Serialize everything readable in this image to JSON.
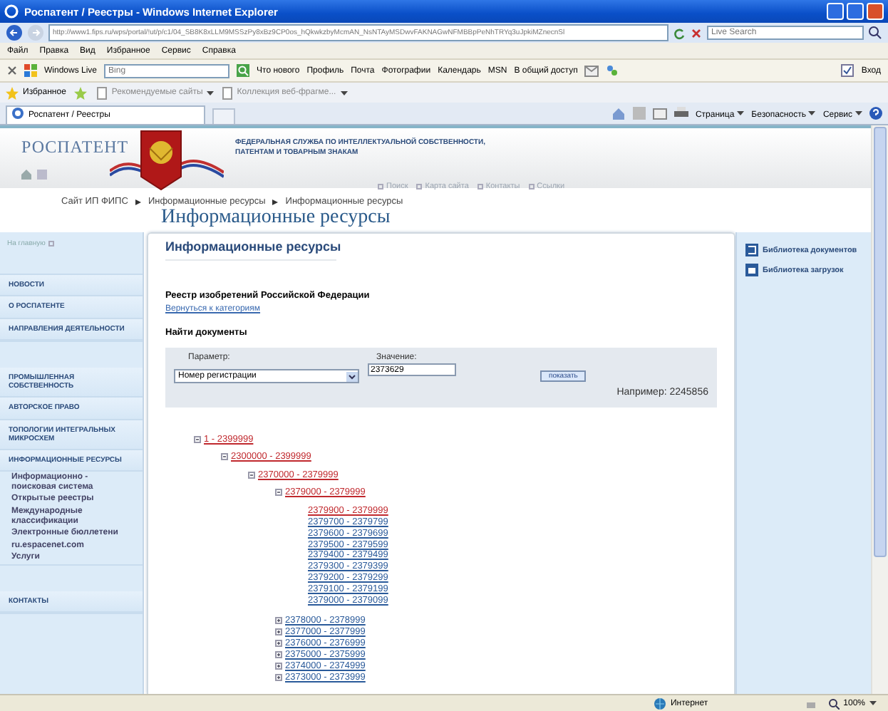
{
  "window": {
    "title": "Роспатент / Реестры - Windows Internet Explorer"
  },
  "browser": {
    "url": "http://www1.fips.ru/wps/portal/!ut/p/c1/04_SB8K8xLLM9MSSzPy8xBz9CP0os_hQkwkzbyMcmAN_NsNTAyMSDwvFAKNAGwNFMBBpPeNhTRYq3uJpkiMZnecnSl",
    "search_placeholder": "Live Search",
    "menu": [
      "Файл",
      "Правка",
      "Вид",
      "Избранное",
      "Сервис",
      "Справка"
    ],
    "live_toolbar": {
      "brand": "Windows Live",
      "search_placeholder": "Bing",
      "links": [
        "Что нового",
        "Профиль",
        "Почта",
        "Фотографии",
        "Календарь",
        "MSN",
        "В общий доступ"
      ],
      "signin": "Вход"
    },
    "favorites": {
      "label": "Избранное",
      "items": [
        "Рекомендуемые сайты",
        "Коллекция веб-фрагме..."
      ]
    },
    "tab": {
      "title": "Роспатент / Реестры"
    },
    "commands": [
      "Страница",
      "Безопасность",
      "Сервис"
    ]
  },
  "page": {
    "header": {
      "logo": "РОСПАТЕНТ",
      "agency_lines": [
        "ФЕДЕРАЛЬНАЯ СЛУЖБА ПО ИНТЕЛЛЕКТУАЛЬНОЙ СОБСТВЕННОСТИ,",
        "ПАТЕНТАМ И ТОВАРНЫМ ЗНАКАМ"
      ],
      "links": [
        "Поиск",
        "Карта сайта",
        "Контакты",
        "Ссылки"
      ]
    },
    "breadcrumb": [
      "Сайт ИП ФИПС",
      "Информационные ресурсы",
      "Информационные ресурсы"
    ],
    "page_title": "Информационные ресурсы",
    "sidebar": {
      "home": "На главную",
      "groups": [
        [
          {
            "label": "НОВОСТИ"
          },
          {
            "label": "О РОСПАТЕНТЕ"
          },
          {
            "label": "НАПРАВЛЕНИЯ ДЕЯТЕЛЬНОСТИ"
          }
        ],
        [
          {
            "label": "ПРОМЫШЛЕННАЯ СОБСТВЕННОСТЬ"
          },
          {
            "label": "АВТОРСКОЕ ПРАВО"
          },
          {
            "label": "ТОПОЛОГИИ ИНТЕГРАЛЬНЫХ МИКРОСХЕМ"
          },
          {
            "label": "ИНФОРМАЦИОННЫЕ РЕСУРСЫ",
            "children": [
              "Информационно - поисковая система",
              "Открытые реестры",
              "Международные классификации",
              "Электронные бюллетени",
              "ru.espacenet.com",
              "Услуги"
            ]
          }
        ],
        [
          {
            "label": "КОНТАКТЫ"
          }
        ]
      ]
    },
    "content": {
      "heading": "Информационные ресурсы",
      "registry_title": "Реестр изобретений Российской Федерации",
      "back_link": "Вернуться к категориям",
      "find_heading": "Найти документы",
      "search": {
        "param_label": "Параметр:",
        "param_value": "Номер регистрации",
        "value_label": "Значение:",
        "value": "2373629",
        "button": "показать",
        "example": "Например: 2245856"
      },
      "tree": [
        {
          "label": "1 - 2399999",
          "kind": "folder",
          "expanded": true,
          "selected": true,
          "children": [
            {
              "label": "2300000 - 2399999",
              "kind": "folder",
              "expanded": true,
              "selected": true,
              "children": [
                {
                  "label": "2370000 - 2379999",
                  "kind": "folder",
                  "expanded": true,
                  "selected": true,
                  "children": [
                    {
                      "label": "2379000 - 2379999",
                      "kind": "folder",
                      "expanded": true,
                      "selected": true,
                      "children": [
                        {
                          "label": "2379900 - 2379999",
                          "kind": "leaf",
                          "selected": true
                        },
                        {
                          "label": "2379700 - 2379799",
                          "kind": "leaf",
                          "selected": false
                        },
                        {
                          "label": "2379600 - 2379699",
                          "kind": "leaf",
                          "selected": false
                        },
                        {
                          "label": "2379500 - 2379599",
                          "kind": "leaf",
                          "selected": false
                        },
                        {
                          "label": "2379400 - 2379499",
                          "kind": "leaf",
                          "selected": false
                        },
                        {
                          "label": "2379300 - 2379399",
                          "kind": "leaf",
                          "selected": false
                        },
                        {
                          "label": "2379200 - 2379299",
                          "kind": "leaf",
                          "selected": false
                        },
                        {
                          "label": "2379100 - 2379199",
                          "kind": "leaf",
                          "selected": false
                        },
                        {
                          "label": "2379000 - 2379099",
                          "kind": "leaf",
                          "selected": false
                        }
                      ]
                    },
                    {
                      "label": "2378000 - 2378999",
                      "kind": "folder",
                      "expanded": false,
                      "selected": false
                    },
                    {
                      "label": "2377000 - 2377999",
                      "kind": "folder",
                      "expanded": false,
                      "selected": false
                    },
                    {
                      "label": "2376000 - 2376999",
                      "kind": "folder",
                      "expanded": false,
                      "selected": false
                    },
                    {
                      "label": "2375000 - 2375999",
                      "kind": "folder",
                      "expanded": false,
                      "selected": false
                    },
                    {
                      "label": "2374000 - 2374999",
                      "kind": "folder",
                      "expanded": false,
                      "selected": false
                    },
                    {
                      "label": "2373000 - 2373999",
                      "kind": "folder",
                      "expanded": false,
                      "selected": false
                    }
                  ]
                }
              ]
            }
          ]
        }
      ]
    },
    "right_links": [
      "Библиотека документов",
      "Библиотека загрузок"
    ]
  },
  "status_bar": {
    "zone": "Интернет",
    "zoom": "100%"
  }
}
